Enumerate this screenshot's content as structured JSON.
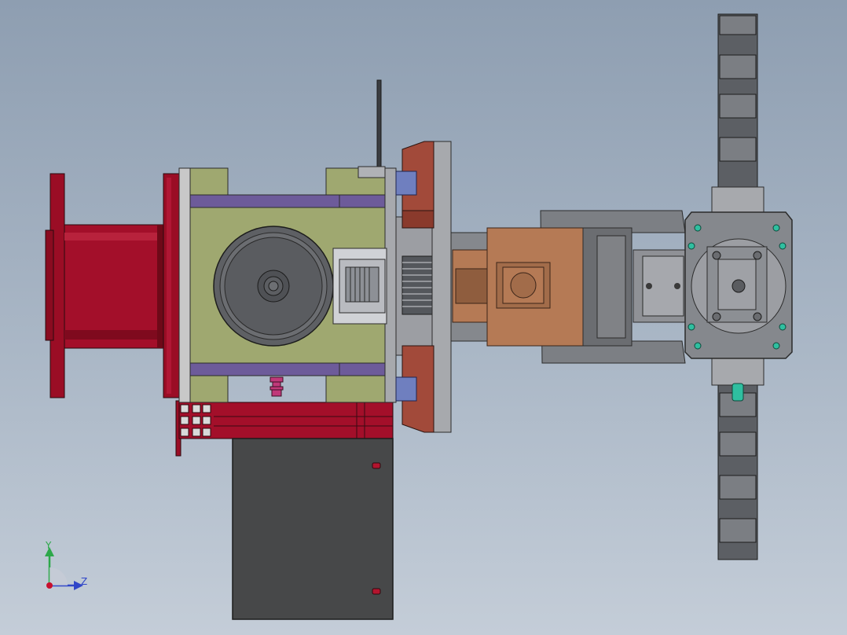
{
  "viewport": {
    "background_top": "#8e9eb1",
    "background_bottom": "#c4cdd8"
  },
  "triad": {
    "y_label": "Y",
    "z_label": "Z",
    "y_color": "#2da84a",
    "z_color": "#2f45c8"
  },
  "colors": {
    "drum_red": "#a30f2a",
    "housing_green": "#9fa870",
    "plate_purple": "#6d5b9a",
    "motor_copper": "#b57a55",
    "flange_rust": "#a24a3a",
    "frame_gray": "#7c7f84",
    "box_dark": "#474849",
    "bearing_blue": "#6f7fbf",
    "teal_part": "#2fbfa0"
  }
}
